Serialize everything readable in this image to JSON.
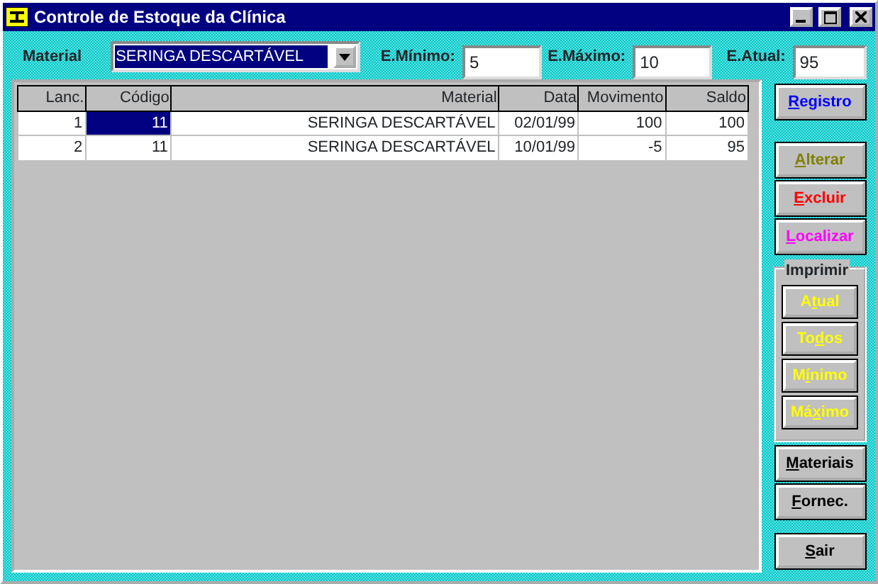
{
  "window": {
    "title": "Controle de Estoque da Clínica"
  },
  "filters": {
    "material_label": "Material",
    "material_value": "SERINGA DESCARTÁVEL",
    "min_label": "E.Mínimo:",
    "min_value": "5",
    "max_label": "E.Máximo:",
    "max_value": "10",
    "current_label": "E.Atual:",
    "current_value": "95"
  },
  "table": {
    "columns": [
      "Lanc.",
      "Código",
      "Material",
      "Data",
      "Movimento",
      "Saldo"
    ],
    "rows": [
      {
        "cells": [
          {
            "text": "1",
            "selected": false
          },
          {
            "text": "11",
            "selected": true
          },
          {
            "text": "SERINGA DESCARTÁVEL",
            "selected": false
          },
          {
            "text": "02/01/99",
            "selected": false
          },
          {
            "text": "100",
            "selected": false
          },
          {
            "text": "100",
            "selected": false
          }
        ]
      },
      {
        "cells": [
          {
            "text": "2",
            "selected": false
          },
          {
            "text": "11",
            "selected": false
          },
          {
            "text": "SERINGA DESCARTÁVEL",
            "selected": false
          },
          {
            "text": "10/01/99",
            "selected": false
          },
          {
            "text": "-5",
            "selected": false
          },
          {
            "text": "95",
            "selected": false
          }
        ]
      }
    ]
  },
  "buttons_top": [
    {
      "key": "R",
      "after": "egistro",
      "color": "#0000ff"
    }
  ],
  "buttons_edit": [
    {
      "key": "A",
      "after": "lterar",
      "color": "#808000"
    },
    {
      "key": "E",
      "after": "xcluir",
      "color": "#ff0000"
    },
    {
      "key": "L",
      "after": "ocalizar",
      "color": "#ff00ff"
    }
  ],
  "print_group": {
    "title": "Imprimir",
    "buttons": [
      {
        "before": "A",
        "key": "t",
        "after": "ual",
        "color": "#ffff00"
      },
      {
        "before": "To",
        "key": "d",
        "after": "os",
        "color": "#ffff00"
      },
      {
        "before": "M",
        "key": "í",
        "after": "nimo",
        "color": "#ffff00"
      },
      {
        "before": "Má",
        "key": "x",
        "after": "imo",
        "color": "#ffff00"
      }
    ]
  },
  "buttons_bottom": [
    {
      "key": "M",
      "after": "ateriais",
      "color": "#000000"
    },
    {
      "key": "F",
      "after": "ornec.",
      "color": "#000000"
    },
    {
      "key": "S",
      "after": "air",
      "color": "#000000"
    }
  ]
}
